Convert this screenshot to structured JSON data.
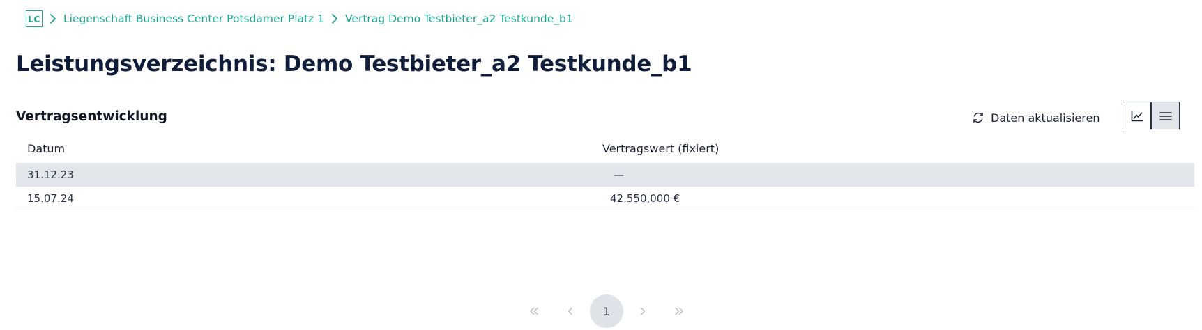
{
  "breadcrumb": {
    "logo_text": "LC",
    "items": [
      {
        "label": "Liegenschaft Business Center Potsdamer Platz 1"
      },
      {
        "label": "Vertrag Demo Testbieter_a2 Testkunde_b1"
      }
    ]
  },
  "page": {
    "title": "Leistungsverzeichnis: Demo Testbieter_a2 Testkunde_b1"
  },
  "section": {
    "title": "Vertragsentwicklung",
    "refresh_label": "Daten aktualisieren",
    "view_toggle": [
      {
        "icon": "line-chart-icon",
        "active": false
      },
      {
        "icon": "list-icon",
        "active": true
      }
    ]
  },
  "table": {
    "columns": [
      "Datum",
      "Vertragswert (fixiert)"
    ],
    "rows": [
      {
        "date": "31.12.23",
        "value": "—",
        "highlighted": true
      },
      {
        "date": "15.07.24",
        "value": "42.550,000 €",
        "highlighted": false
      }
    ]
  },
  "pagination": {
    "current_page": "1"
  },
  "colors": {
    "accent": "#1ba391",
    "title": "#0f1d3a",
    "row_highlight": "#e2e5ea"
  }
}
